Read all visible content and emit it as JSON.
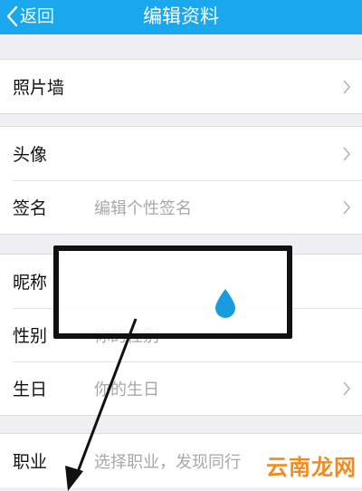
{
  "nav": {
    "back_label": "返回",
    "title": "编辑资料"
  },
  "rows": {
    "photo_wall": {
      "label": "照片墙"
    },
    "avatar": {
      "label": "头像"
    },
    "signature": {
      "label": "签名",
      "placeholder": "编辑个性签名"
    },
    "nickname": {
      "label": "昵称"
    },
    "gender": {
      "label": "性别",
      "placeholder": "你的性别"
    },
    "birthday": {
      "label": "生日",
      "placeholder": "你的生日"
    },
    "occupation": {
      "label": "职业",
      "placeholder": "选择职业，发现同行"
    }
  },
  "watermark": "云南龙网",
  "colors": {
    "nav_bg": "#19a7ee",
    "drop": "#1a9be0",
    "watermark": "#f28b1e"
  }
}
